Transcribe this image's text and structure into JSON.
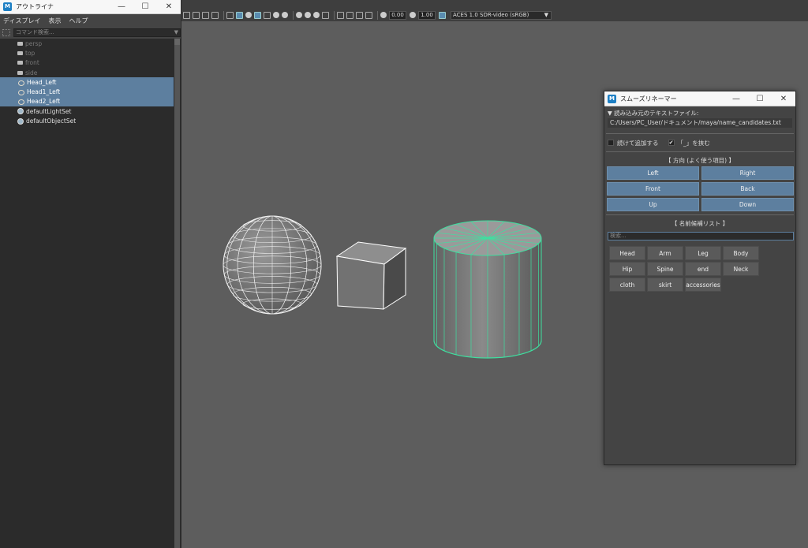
{
  "outliner": {
    "title": "アウトライナ",
    "menu": [
      "ディスプレイ",
      "表示",
      "ヘルプ"
    ],
    "search_placeholder": "コマンド検索...",
    "items": [
      {
        "label": "persp",
        "type": "camera",
        "selected": false,
        "dim": true
      },
      {
        "label": "top",
        "type": "camera",
        "selected": false,
        "dim": true
      },
      {
        "label": "front",
        "type": "camera",
        "selected": false,
        "dim": true
      },
      {
        "label": "side",
        "type": "camera",
        "selected": false,
        "dim": true
      },
      {
        "label": "Head_Left",
        "type": "transform",
        "selected": true,
        "dim": false
      },
      {
        "label": "Head1_Left",
        "type": "transform",
        "selected": true,
        "dim": false
      },
      {
        "label": "Head2_Left",
        "type": "transform",
        "selected": true,
        "dim": false
      },
      {
        "label": "defaultLightSet",
        "type": "set",
        "selected": false,
        "dim": false
      },
      {
        "label": "defaultObjectSet",
        "type": "set",
        "selected": false,
        "dim": false
      }
    ]
  },
  "viewport_toolbar": {
    "exposure": "0.00",
    "gamma": "1.00",
    "color_space": "ACES 1.0 SDR-video (sRGB)"
  },
  "renamer": {
    "title": "スムーズリネーマー",
    "source_label": "▼ 読み込み元のテキストファイル:",
    "file_path": "C:/Users/PC_User/ドキュメント/maya/name_candidates.txt",
    "option_append": "続けて追加する",
    "option_underscore": "「_」を挟む",
    "option_append_checked": false,
    "option_underscore_checked": true,
    "direction_header": "【 方向 (よく使う項目) 】",
    "directions": [
      "Left",
      "Right",
      "Front",
      "Back",
      "Up",
      "Down"
    ],
    "candidate_header": "【 名前候補リスト 】",
    "candidate_search_placeholder": "検索...",
    "candidates": [
      "Head",
      "Arm",
      "Leg",
      "Body",
      "Hip",
      "Spine",
      "end",
      "Neck",
      "cloth",
      "skirt",
      "accessories"
    ]
  },
  "colors": {
    "selection": "#5d7f9f",
    "wire_highlight": "#3ee0a0",
    "viewport_bg": "#5d5d5d"
  }
}
